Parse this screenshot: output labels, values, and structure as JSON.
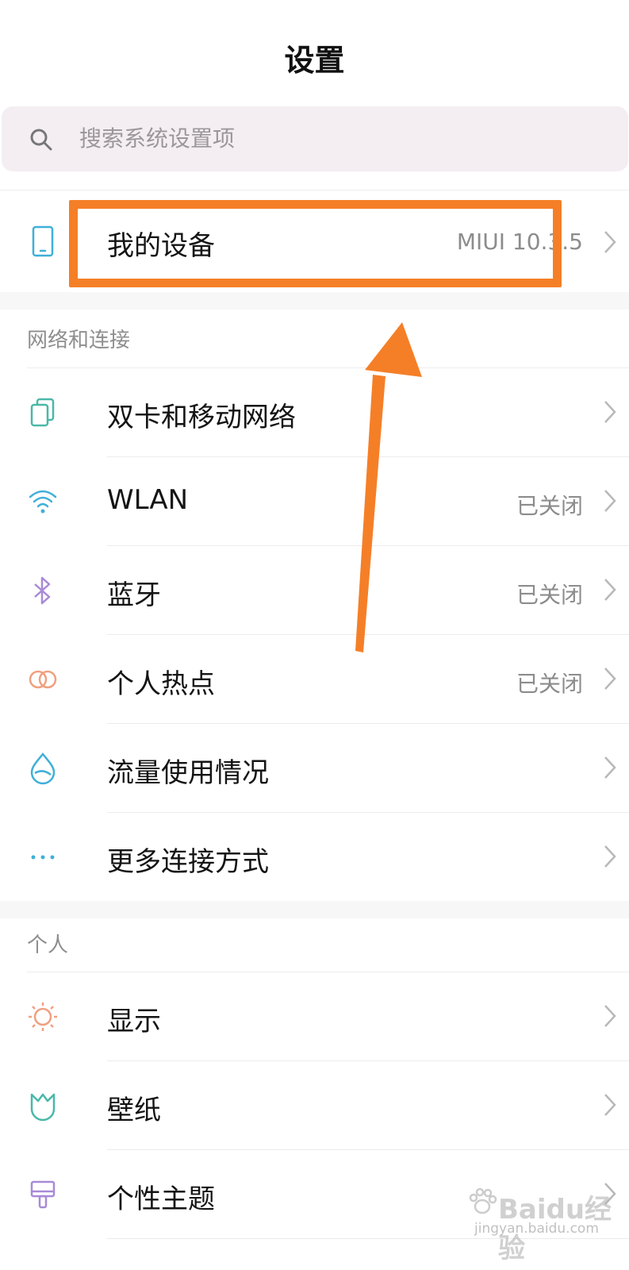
{
  "header": {
    "title": "设置"
  },
  "search": {
    "placeholder": "搜索系统设置项"
  },
  "device": {
    "label": "我的设备",
    "value": "MIUI 10.3.5"
  },
  "sections": {
    "network": {
      "header": "网络和连接",
      "items": [
        {
          "label": "双卡和移动网络",
          "value": ""
        },
        {
          "label": "WLAN",
          "value": "已关闭"
        },
        {
          "label": "蓝牙",
          "value": "已关闭"
        },
        {
          "label": "个人热点",
          "value": "已关闭"
        },
        {
          "label": "流量使用情况",
          "value": ""
        },
        {
          "label": "更多连接方式",
          "value": ""
        }
      ]
    },
    "personal": {
      "header": "个人",
      "items": [
        {
          "label": "显示"
        },
        {
          "label": "壁纸"
        },
        {
          "label": "个性主题"
        }
      ]
    }
  },
  "icons": {
    "device": "phone-icon",
    "sim": "sim-card-icon",
    "wlan": "wifi-icon",
    "bluetooth": "bluetooth-icon",
    "hotspot": "hotspot-icon",
    "data": "data-usage-icon",
    "more": "more-icon",
    "display": "display-icon",
    "wallpaper": "wallpaper-icon",
    "theme": "theme-icon"
  },
  "annotation": {
    "color": "#f57f27"
  },
  "watermark": {
    "text": "Baidu经验",
    "url": "jingyan.baidu.com"
  }
}
